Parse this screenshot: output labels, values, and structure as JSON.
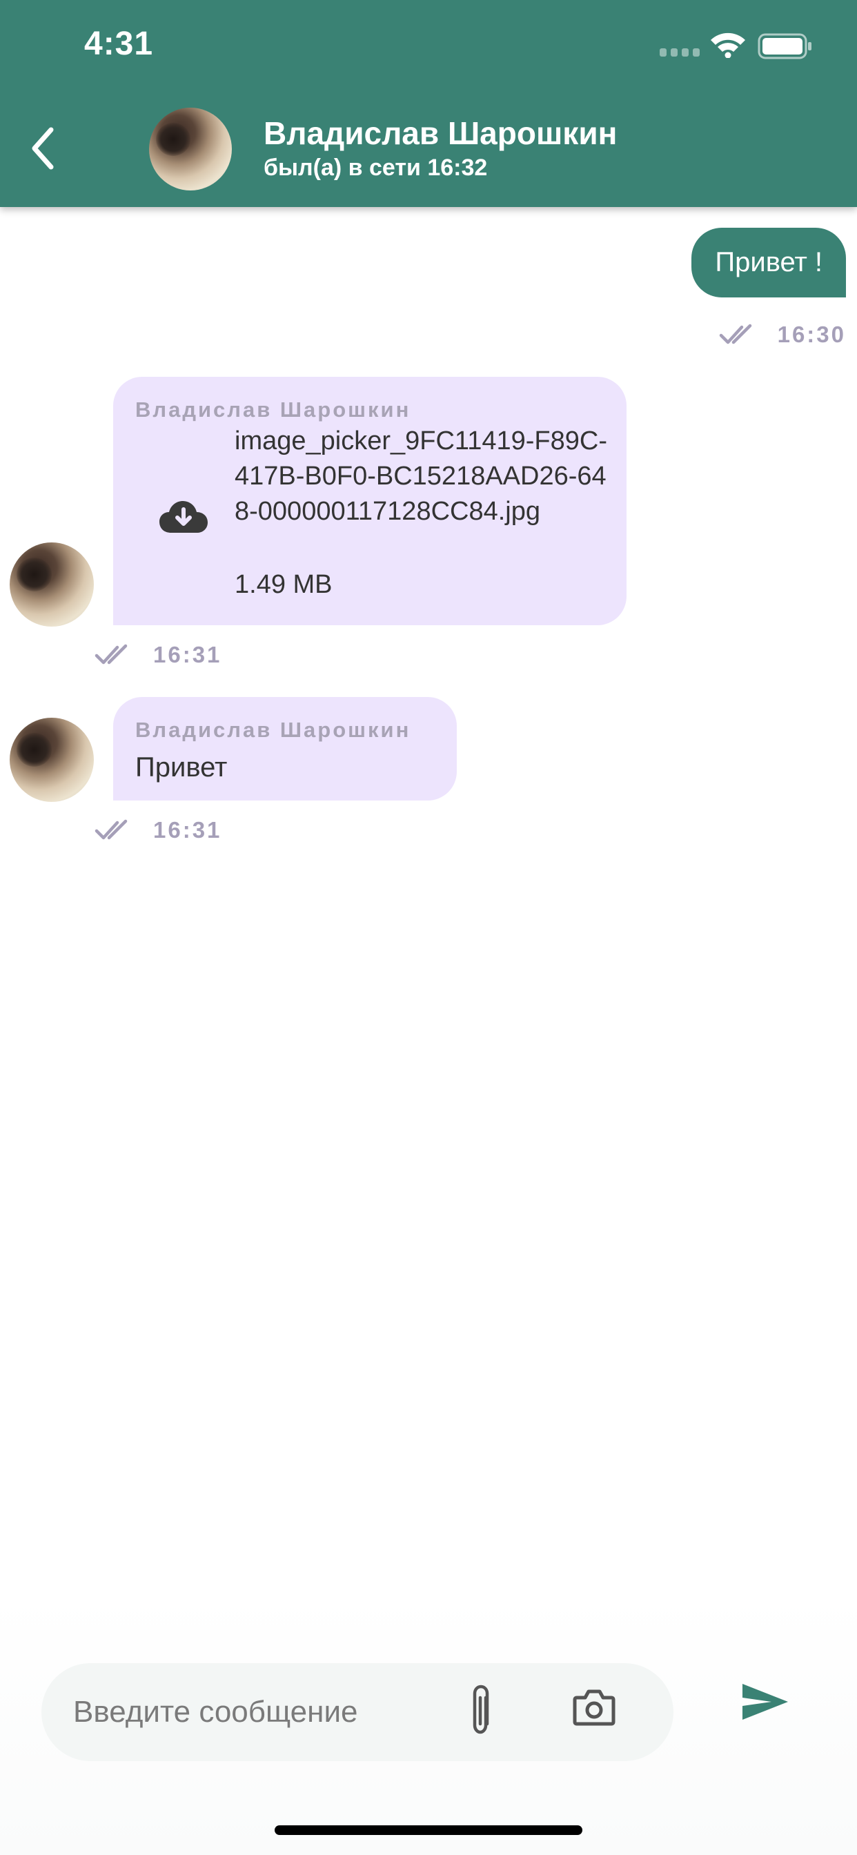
{
  "status_bar": {
    "time": "4:31"
  },
  "header": {
    "contact_name": "Владислав Шарошкин",
    "contact_status": "был(а) в сети 16:32"
  },
  "messages": {
    "outgoing": [
      {
        "text": "Привет !",
        "time": "16:30"
      }
    ],
    "incoming": [
      {
        "sender": "Владислав Шарошкин",
        "file_name": "image_picker_9FC11419-F89C-417B-B0F0-BC15218AAD26-648-000000117128CC84.jpg",
        "file_size": "1.49 MB",
        "time": "16:31"
      },
      {
        "sender": "Владислав Шарошкин",
        "text": "Привет",
        "time": "16:31"
      }
    ]
  },
  "composer": {
    "placeholder": "Введите сообщение",
    "value": ""
  },
  "icons": {
    "back": "chevron-left-icon",
    "download": "cloud-download-icon",
    "read_receipt": "double-check-icon",
    "attach": "paperclip-icon",
    "camera": "camera-icon",
    "send": "send-icon"
  },
  "colors": {
    "primary": "#3a8274",
    "incoming_bubble": "#ede4fd",
    "meta_text": "#a59fb8"
  }
}
